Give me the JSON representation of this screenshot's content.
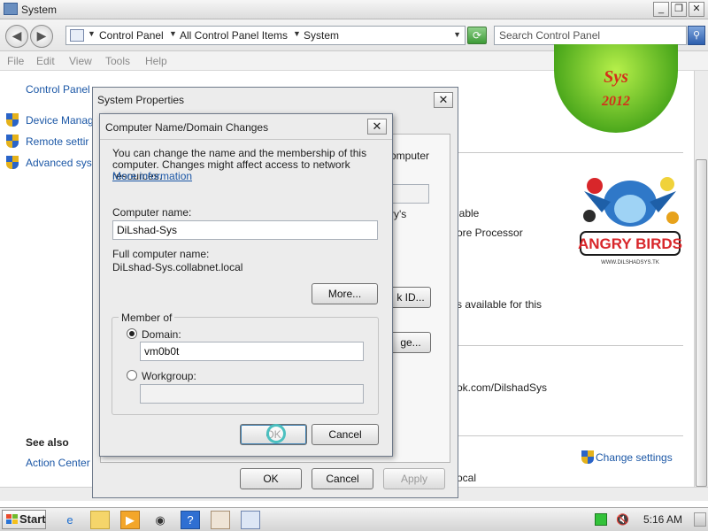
{
  "window": {
    "title": "System",
    "minimize": "_",
    "maximize": "❐",
    "close": "✕"
  },
  "address": {
    "crumbs": [
      "Control Panel",
      "All Control Panel Items",
      "System"
    ],
    "search_placeholder": "Search Control Panel"
  },
  "menu": [
    "File",
    "Edit",
    "View",
    "Tools",
    "Help"
  ],
  "left_pane": {
    "home": "Control Panel",
    "links": [
      "Device Manag",
      "Remote settir",
      "Advanced sys"
    ],
    "see_also_heading": "See also",
    "see_also_links": [
      "Action Center"
    ]
  },
  "background_content": {
    "logo_text_top": "Sys",
    "logo_text_year": "2012",
    "fragments": [
      "lable",
      "ore Processor",
      "s available for this",
      "ok.com/DilshadSys",
      "ocal"
    ],
    "change_settings": "Change settings"
  },
  "system_properties": {
    "title": "System Properties",
    "fragments": [
      "omputer",
      "ry's",
      "k ID...",
      "ge..."
    ],
    "ok": "OK",
    "cancel": "Cancel",
    "apply": "Apply"
  },
  "domain_dialog": {
    "title": "Computer Name/Domain Changes",
    "description_line1": "You can change the name and the membership of this",
    "description_line2": "computer. Changes might affect access to network resources.",
    "more_information": "More information",
    "computer_name_label": "Computer name:",
    "computer_name_value": "DiLshad-Sys",
    "full_name_label": "Full computer name:",
    "full_name_value": "DiLshad-Sys.collabnet.local",
    "more_button": "More...",
    "member_of_label": "Member of",
    "domain_label": "Domain:",
    "domain_selected": true,
    "domain_value": "vm0b0t",
    "workgroup_label": "Workgroup:",
    "workgroup_value": "",
    "ok": "OK",
    "cancel": "Cancel"
  },
  "taskbar": {
    "start": "Start",
    "clock": "5:16 AM"
  },
  "colors": {
    "link": "#1b57a6",
    "dialog_bg": "#ececec",
    "focus_ring": "#4cc0c0"
  }
}
